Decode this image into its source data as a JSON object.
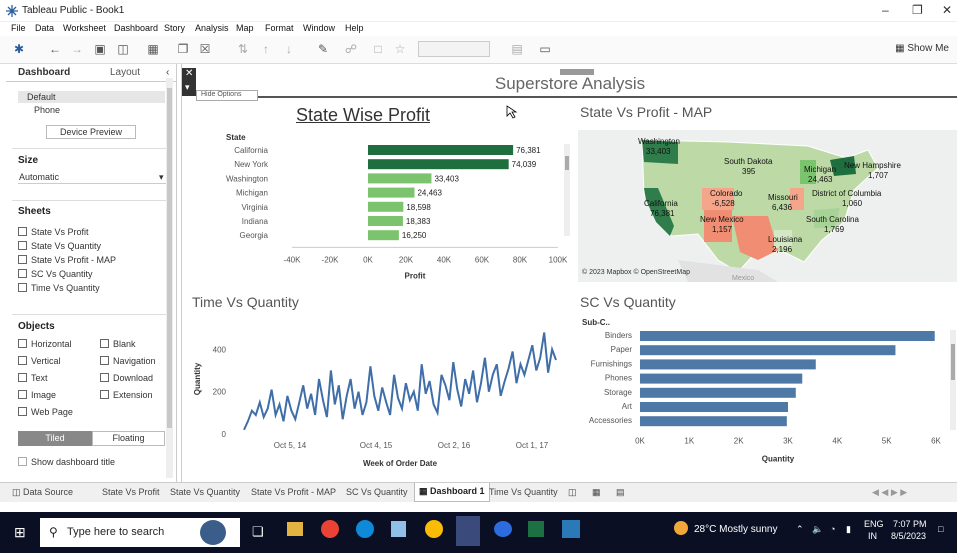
{
  "window": {
    "title": "Tableau Public - Book1"
  },
  "menu": [
    "File",
    "Data",
    "Worksheet",
    "Dashboard",
    "Story",
    "Analysis",
    "Map",
    "Format",
    "Window",
    "Help"
  ],
  "toolbar": {
    "show_me": "Show Me"
  },
  "sidebar": {
    "tabs": {
      "dashboard": "Dashboard",
      "layout": "Layout"
    },
    "devices": [
      "Default",
      "Phone"
    ],
    "device_preview": "Device Preview",
    "size_header": "Size",
    "size_value": "Automatic",
    "sheets_header": "Sheets",
    "sheets": [
      "State Vs Profit",
      "State Vs Quantity",
      "State Vs Profit - MAP",
      "SC Vs Quantity",
      "Time Vs Quantity"
    ],
    "objects_header": "Objects",
    "objects_left": [
      "Horizontal",
      "Vertical",
      "Text",
      "Image",
      "Web Page"
    ],
    "objects_right": [
      "Blank",
      "Navigation",
      "Download",
      "Extension"
    ],
    "tiled": "Tiled",
    "floating": "Floating",
    "show_title": "Show dashboard title"
  },
  "dashboard": {
    "title": "Superstore Analysis",
    "hide_options": "Hide Options",
    "panels": {
      "state_profit": "State Wise Profit",
      "map": "State Vs Profit - MAP",
      "time_qty": "Time Vs Quantity",
      "sc_qty": "SC Vs Quantity"
    },
    "map_credit": "© 2023 Mapbox © OpenStreetMap",
    "map_labels": [
      {
        "state": "Washington",
        "value": "33,403"
      },
      {
        "state": "California",
        "value": "76,381"
      },
      {
        "state": "South Dakota",
        "value": "395"
      },
      {
        "state": "Colorado",
        "value": "-6,528"
      },
      {
        "state": "New Mexico",
        "value": "1,157"
      },
      {
        "state": "Missouri",
        "value": "6,436"
      },
      {
        "state": "Louisiana",
        "value": "2,196"
      },
      {
        "state": "Michigan",
        "value": "24,463"
      },
      {
        "state": "New Hampshire",
        "value": "1,707"
      },
      {
        "state": "District of Columbia",
        "value": "1,060"
      },
      {
        "state": "South Carolina",
        "value": "1,769"
      },
      {
        "state": "Mexico",
        "value": ""
      }
    ]
  },
  "chart_data": [
    {
      "type": "bar",
      "title": "State Wise Profit",
      "xlabel": "Profit",
      "ylabel": "State",
      "categories": [
        "California",
        "New York",
        "Washington",
        "Michigan",
        "Virginia",
        "Indiana",
        "Georgia"
      ],
      "values": [
        76381,
        74039,
        33403,
        24463,
        18598,
        18383,
        16250
      ],
      "value_labels": [
        "76,381",
        "74,039",
        "33,403",
        "24,463",
        "18,598",
        "18,383",
        "16,250"
      ],
      "xticks": [
        "-40K",
        "-20K",
        "0K",
        "20K",
        "40K",
        "60K",
        "80K",
        "100K"
      ],
      "xlim": [
        -40000,
        100000
      ]
    },
    {
      "type": "line",
      "title": "Time Vs Quantity",
      "xlabel": "Week of Order Date",
      "ylabel": "Quantity",
      "xticks": [
        "Oct 5, 14",
        "Oct 4, 15",
        "Oct 2, 16",
        "Oct 1, 17"
      ],
      "yticks": [
        "0",
        "200",
        "400"
      ],
      "ylim": [
        0,
        520
      ],
      "values": [
        20,
        60,
        110,
        90,
        150,
        80,
        120,
        210,
        90,
        140,
        60,
        180,
        110,
        70,
        150,
        230,
        120,
        190,
        90,
        260,
        160,
        80,
        300,
        140,
        230,
        70,
        180,
        260,
        120,
        200,
        90,
        150,
        320,
        180,
        110,
        220,
        150,
        90,
        280,
        170,
        120,
        240,
        160,
        200,
        110,
        330,
        190,
        250,
        140,
        100,
        280,
        230,
        160,
        340,
        210,
        130,
        260,
        190,
        300,
        150,
        240,
        360,
        200,
        280,
        330,
        180,
        250,
        310,
        390,
        240,
        330,
        280,
        350,
        420,
        300,
        360,
        480,
        290,
        400,
        350
      ]
    },
    {
      "type": "bar",
      "title": "SC Vs Quantity",
      "xlabel": "Quantity",
      "ylabel": "Sub-C..",
      "categories": [
        "Binders",
        "Paper",
        "Furnishings",
        "Phones",
        "Storage",
        "Art",
        "Accessories"
      ],
      "values": [
        5974,
        5178,
        3563,
        3289,
        3158,
        3000,
        2976
      ],
      "xticks": [
        "0K",
        "1K",
        "2K",
        "3K",
        "4K",
        "5K",
        "6K"
      ],
      "xlim": [
        0,
        6000
      ]
    }
  ],
  "sheet_tabs": [
    "Data Source",
    "State Vs Profit",
    "State Vs Quantity",
    "State Vs Profit - MAP",
    "SC Vs Quantity",
    "Dashboard 1",
    "Time Vs Quantity"
  ],
  "taskbar": {
    "search_placeholder": "Type here to search",
    "weather": "28°C  Mostly sunny",
    "lang": "ENG",
    "region": "IN",
    "time": "7:07 PM",
    "date": "8/5/2023"
  },
  "colors": {
    "profit_dark": "#1e6e3e",
    "profit_light": "#7cc36e",
    "sc_bar": "#4e79a7",
    "line": "#3f6ea8"
  }
}
